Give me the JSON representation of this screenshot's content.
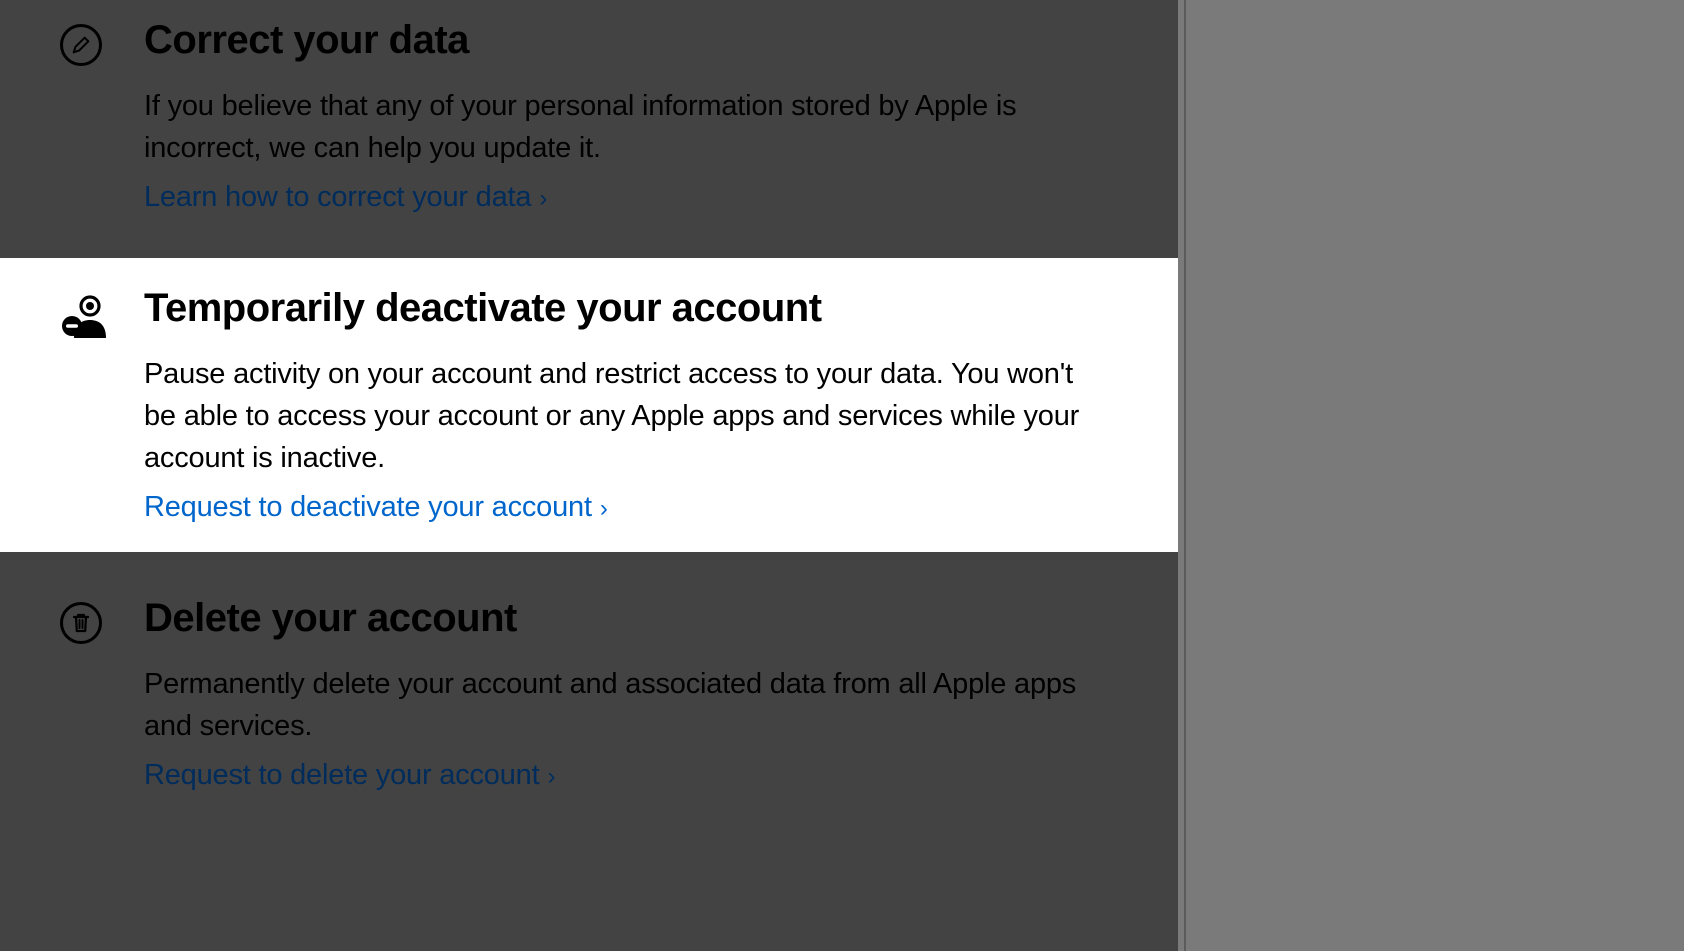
{
  "sections": {
    "correct": {
      "title": "Correct your data",
      "desc": "If you believe that any of your personal information stored by Apple is incorrect, we can help you update it.",
      "link": "Learn how to correct your data"
    },
    "deactivate": {
      "title": "Temporarily deactivate your account",
      "desc": "Pause activity on your account and restrict access to your data. You won't be able to access your account or any Apple apps and services while your account is inactive.",
      "link": "Request to deactivate your account"
    },
    "delete": {
      "title": "Delete your account",
      "desc": "Permanently delete your account and associated data from all Apple apps and services.",
      "link": "Request to delete your account"
    }
  }
}
